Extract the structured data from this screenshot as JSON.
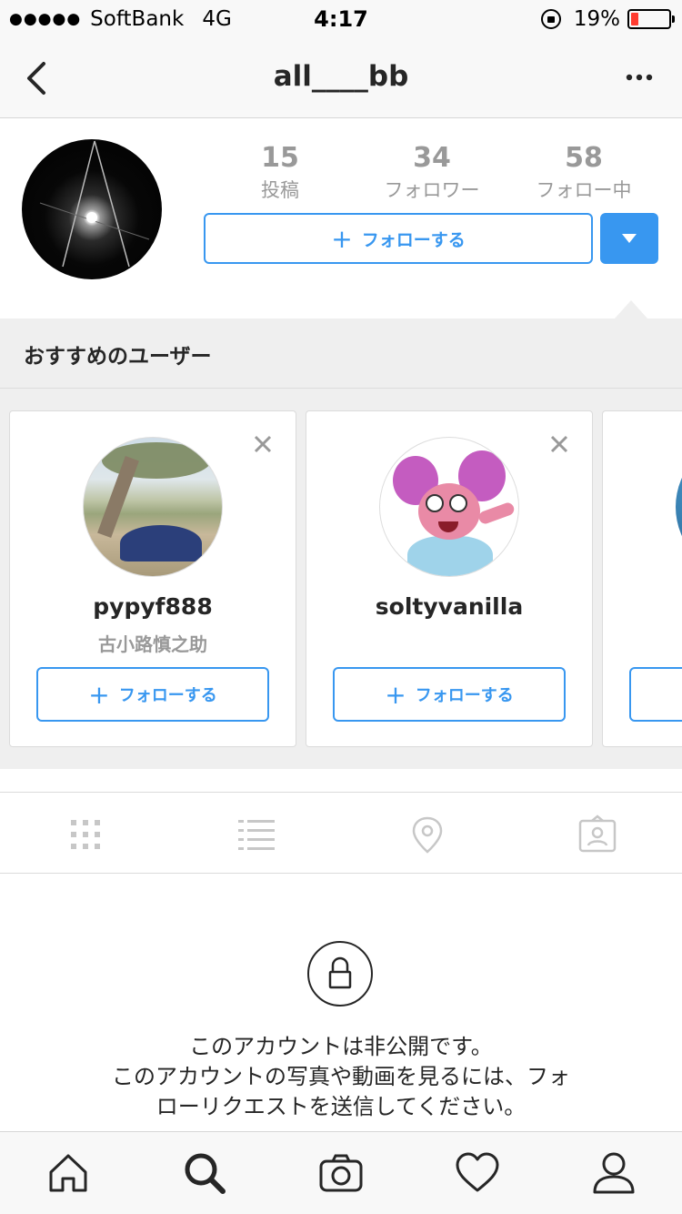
{
  "status_bar": {
    "signal": "●●●●●",
    "carrier": "SoftBank",
    "network": "4G",
    "time": "4:17",
    "battery_percent": "19%",
    "battery_level": 0.19
  },
  "nav": {
    "title": "all____bb",
    "back_icon": "chevron-left-icon",
    "more_icon": "ellipsis-icon"
  },
  "profile": {
    "stats": [
      {
        "value": "15",
        "label": "投稿"
      },
      {
        "value": "34",
        "label": "フォロワー"
      },
      {
        "value": "58",
        "label": "フォロー中"
      }
    ],
    "follow_button": "フォローする"
  },
  "suggested": {
    "title": "おすすめのユーザー",
    "cards": [
      {
        "username": "pypyf888",
        "full_name": "古小路慎之助",
        "follow": "フォローする"
      },
      {
        "username": "soltyvanilla",
        "full_name": "",
        "follow": "フォローする"
      }
    ]
  },
  "view_tabs": [
    "grid-icon",
    "list-icon",
    "location-icon",
    "tagged-icon"
  ],
  "private": {
    "line1": "このアカウントは非公開です。",
    "line2": "このアカウントの写真や動画を見るには、フォ",
    "line3": "ローリクエストを送信してください。"
  },
  "bottom_tabs": [
    "home-icon",
    "search-icon",
    "camera-icon",
    "heart-icon",
    "profile-icon"
  ],
  "colors": {
    "accent": "#3897f0",
    "battery_low": "#ff3b30"
  }
}
